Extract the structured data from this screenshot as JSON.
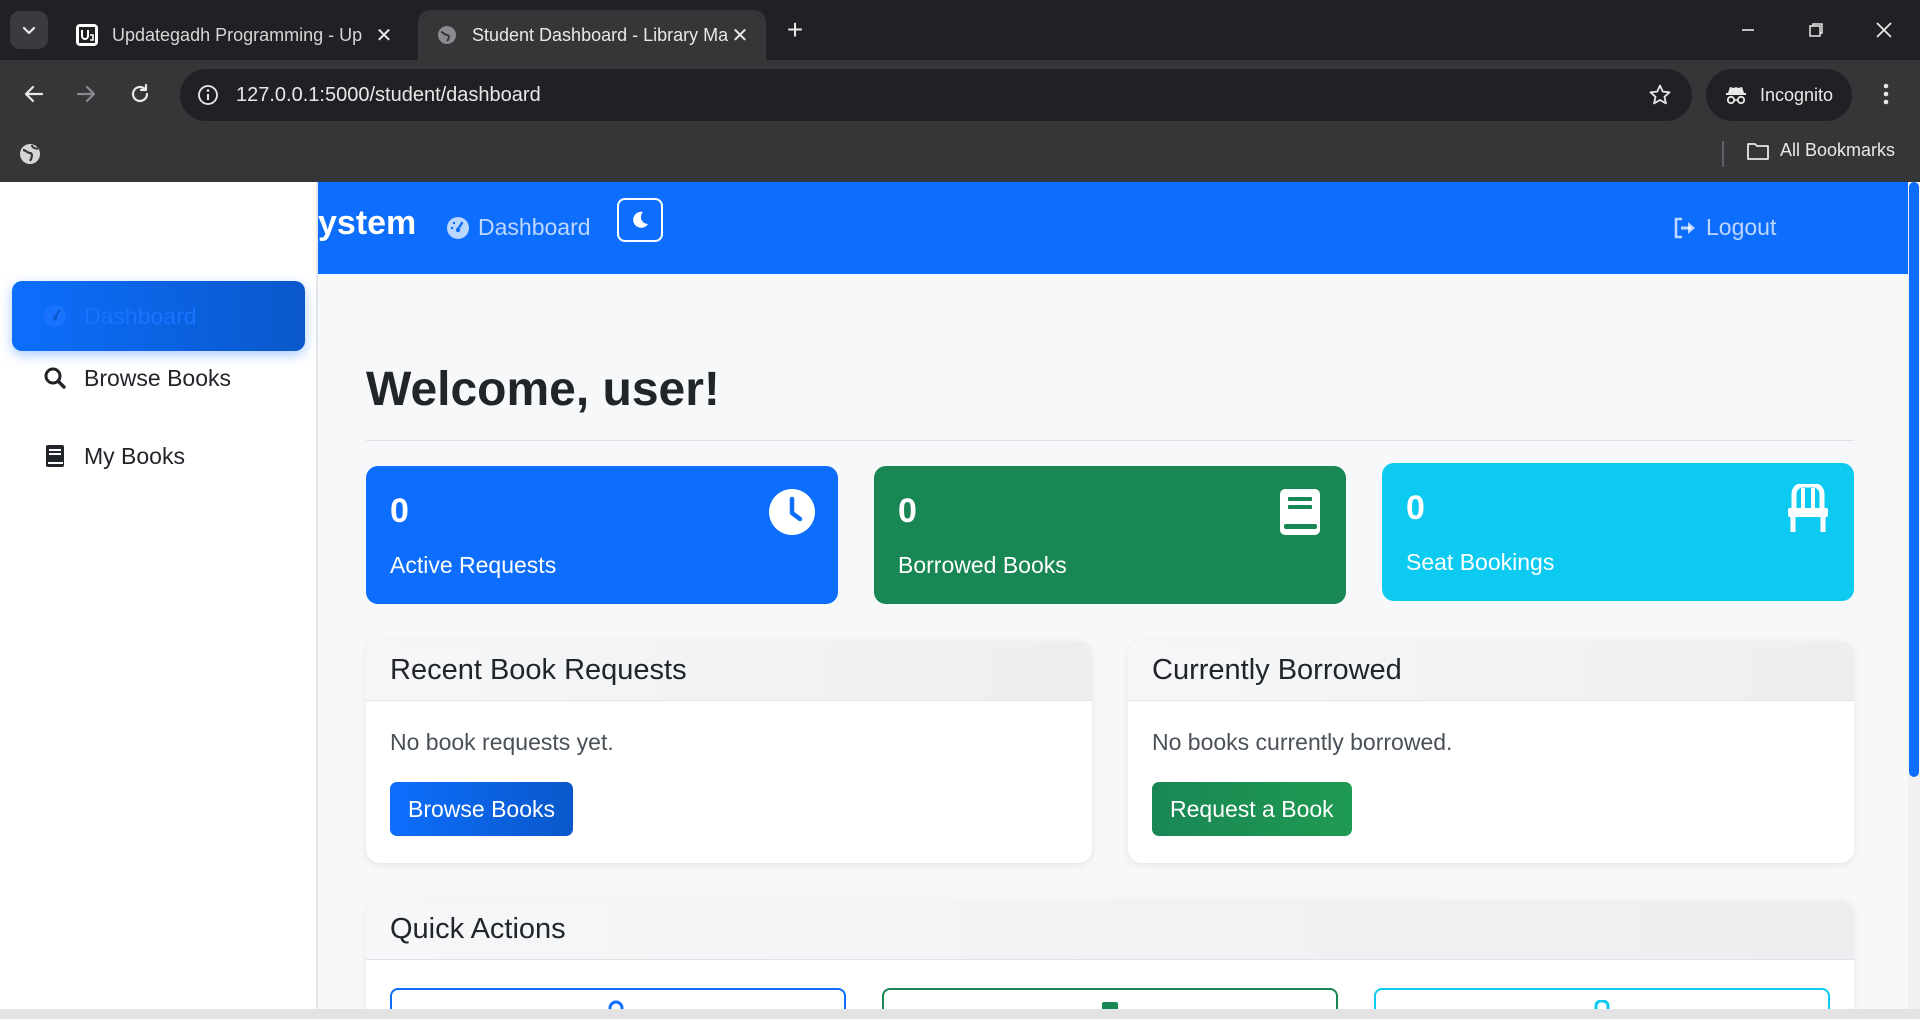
{
  "browser": {
    "tabs": [
      {
        "title": "Updategadh Programming - Up",
        "active": false
      },
      {
        "title": "Student Dashboard - Library Ma",
        "active": true
      }
    ],
    "url": "127.0.0.1:5000/student/dashboard",
    "profile_label": "Incognito",
    "bookmarks_label": "All Bookmarks"
  },
  "sidebar": {
    "items": [
      {
        "label": "Dashboard",
        "icon": "tachometer-icon",
        "active": true
      },
      {
        "label": "Browse Books",
        "icon": "search-icon",
        "active": false
      },
      {
        "label": "My Books",
        "icon": "book-icon",
        "active": false
      }
    ]
  },
  "navbar": {
    "brand": "ystem",
    "dashboard_link": "Dashboard",
    "logout_link": "Logout"
  },
  "main": {
    "welcome": "Welcome, user!",
    "stats": [
      {
        "value": "0",
        "label": "Active Requests",
        "icon": "clock-icon",
        "color": "#0d6efd"
      },
      {
        "value": "0",
        "label": "Borrowed Books",
        "icon": "book-icon",
        "color": "#198754"
      },
      {
        "value": "0",
        "label": "Seat Bookings",
        "icon": "chair-icon",
        "color": "#0dcaf0"
      }
    ],
    "recent_requests": {
      "title": "Recent Book Requests",
      "message": "No book requests yet.",
      "button": "Browse Books"
    },
    "currently_borrowed": {
      "title": "Currently Borrowed",
      "message": "No books currently borrowed.",
      "button": "Request a Book"
    },
    "quick_actions": {
      "title": "Quick Actions"
    }
  },
  "colors": {
    "primary": "#0d6efd",
    "success": "#198754",
    "info": "#0dcaf0"
  }
}
